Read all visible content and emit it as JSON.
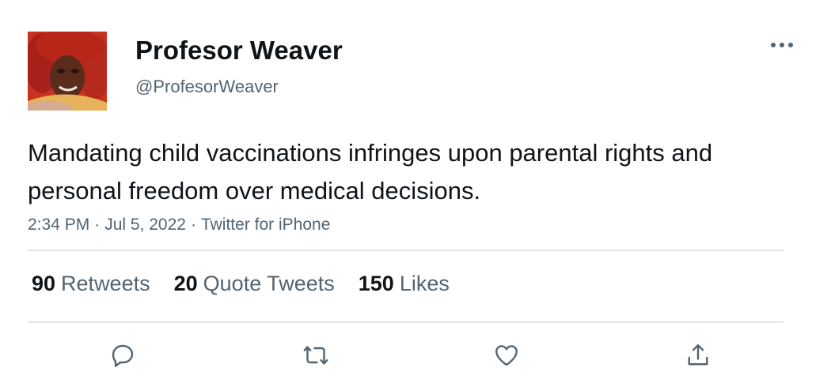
{
  "user": {
    "display_name": "Profesor Weaver",
    "handle": "@ProfesorWeaver",
    "avatar_icon": "profile-photo"
  },
  "tweet": {
    "text": "Mandating child vaccinations infringes upon parental rights and personal freedom over medical decisions.",
    "time": "2:34 PM",
    "date": "Jul 5, 2022",
    "source": "Twitter for iPhone",
    "separator": "·"
  },
  "stats": {
    "retweets": {
      "count": "90",
      "label": "Retweets"
    },
    "quote_tweets": {
      "count": "20",
      "label": "Quote Tweets"
    },
    "likes": {
      "count": "150",
      "label": "Likes"
    }
  },
  "actions": {
    "reply_icon": "reply-icon",
    "retweet_icon": "retweet-icon",
    "like_icon": "heart-icon",
    "share_icon": "share-icon",
    "more_icon": "more-icon"
  },
  "colors": {
    "text_primary": "#0f1419",
    "text_secondary": "#536471",
    "divider": "#e1e6ea",
    "icon": "#536471"
  }
}
